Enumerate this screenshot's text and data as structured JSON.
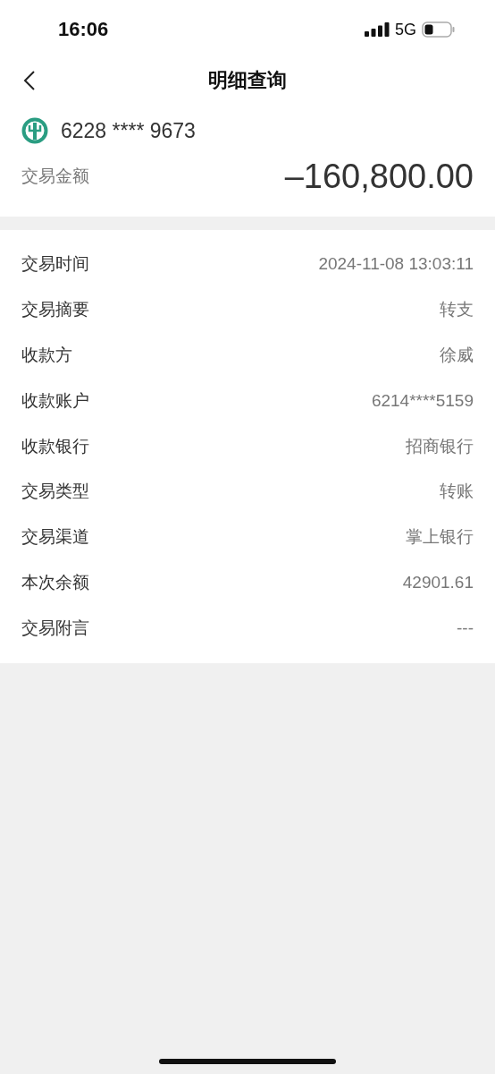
{
  "status_bar": {
    "time": "16:06",
    "network": "5G"
  },
  "nav": {
    "title": "明细查询"
  },
  "account": {
    "number": "6228 **** 9673",
    "amount_label": "交易金额",
    "amount": "–160,800.00"
  },
  "details": [
    {
      "label": "交易时间",
      "value": "2024-11-08 13:03:11"
    },
    {
      "label": "交易摘要",
      "value": "转支"
    },
    {
      "label": "收款方",
      "value": "徐威"
    },
    {
      "label": "收款账户",
      "value": "6214****5159"
    },
    {
      "label": "收款银行",
      "value": "招商银行"
    },
    {
      "label": "交易类型",
      "value": "转账"
    },
    {
      "label": "交易渠道",
      "value": "掌上银行"
    },
    {
      "label": "本次余额",
      "value": "42901.61"
    },
    {
      "label": "交易附言",
      "value": "---"
    }
  ]
}
